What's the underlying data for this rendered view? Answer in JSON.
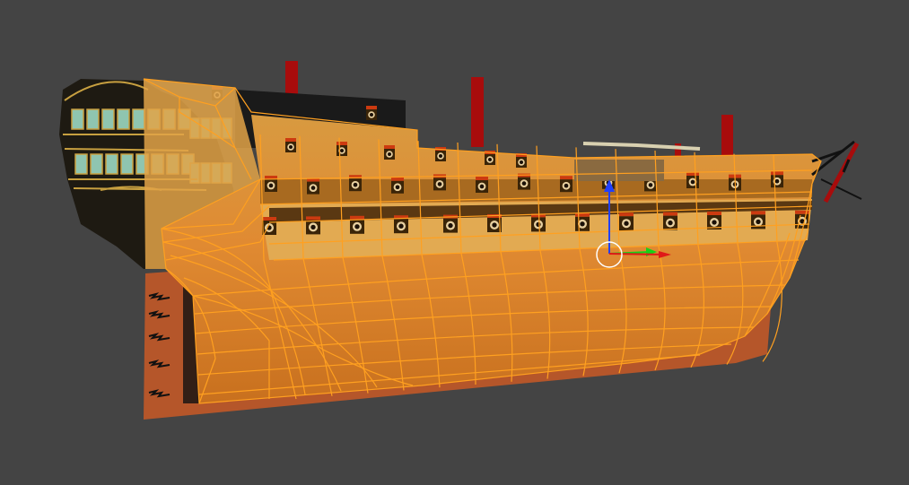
{
  "viewport": {
    "background": "#444444"
  },
  "colors": {
    "wireframe": "#ffa020",
    "hull_lower": "#e08a32",
    "hull_upper": "#d89a40",
    "hull_dark": "#7a4a18",
    "stern_dark": "#1e1a12",
    "stern_gold": "#c8a040",
    "window_glass": "#8fc5b0",
    "keel": "#b5562a",
    "mast_red": "#a80c0c",
    "gun_port": "#cc3a10",
    "gizmo_x": "#18d018",
    "gizmo_y": "#2040ff",
    "gizmo_z": "#e01818",
    "gizmo_ring": "#ffffff"
  },
  "scene": {
    "object": "ship-hull",
    "selection_mode": "wireframe-overlay",
    "transform_gizmo": {
      "type": "move",
      "axes": [
        "x-axis-icon",
        "y-axis-icon",
        "z-axis-icon"
      ]
    }
  }
}
